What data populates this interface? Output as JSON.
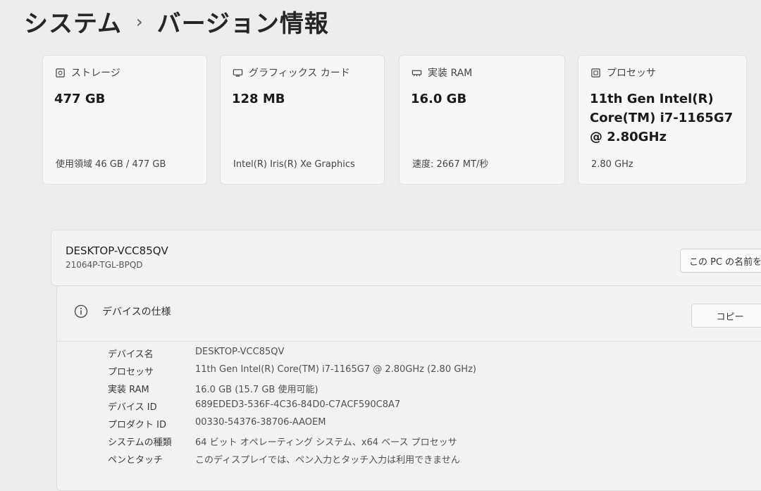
{
  "header": {
    "parent": "システム",
    "separator": "›",
    "title": "バージョン情報"
  },
  "cards": [
    {
      "id": "storage",
      "label": "ストレージ",
      "icon": "storage-icon",
      "value": "477 GB",
      "detail": "使用領域 46 GB / 477 GB"
    },
    {
      "id": "graphics",
      "label": "グラフィックス カード",
      "icon": "graphics-card-icon",
      "value": "128 MB",
      "detail": "Intel(R) Iris(R) Xe Graphics"
    },
    {
      "id": "ram",
      "label": "実装 RAM",
      "icon": "ram-icon",
      "value": "16.0 GB",
      "detail": "速度: 2667 MT/秒"
    },
    {
      "id": "processor",
      "label": "プロセッサ",
      "icon": "processor-icon",
      "value": "11th Gen Intel(R) Core(TM) i7-1165G7 @ 2.80GHz",
      "detail": "2.80 GHz"
    }
  ],
  "device": {
    "name": "DESKTOP-VCC85QV",
    "model": "21064P-TGL-BPQD",
    "rename_label": "この PC の名前を変更"
  },
  "specs": {
    "title": "デバイスの仕様",
    "copy_label": "コピー",
    "rows": [
      {
        "label": "デバイス名",
        "value": "DESKTOP-VCC85QV"
      },
      {
        "label": "プロセッサ",
        "value": "11th Gen Intel(R) Core(TM) i7-1165G7 @ 2.80GHz (2.80 GHz)"
      },
      {
        "label": "実装 RAM",
        "value": "16.0 GB (15.7 GB 使用可能)"
      },
      {
        "label": "デバイス ID",
        "value": "689EDED3-536F-4C36-84D0-C7ACF590C8A7"
      },
      {
        "label": "プロダクト ID",
        "value": "00330-54376-38706-AAOEM"
      },
      {
        "label": "システムの種類",
        "value": "64 ビット オペレーティング システム、x64 ベース プロセッサ"
      },
      {
        "label": "ペンとタッチ",
        "value": "このディスプレイでは、ペン入力とタッチ入力は利用できません"
      }
    ]
  }
}
